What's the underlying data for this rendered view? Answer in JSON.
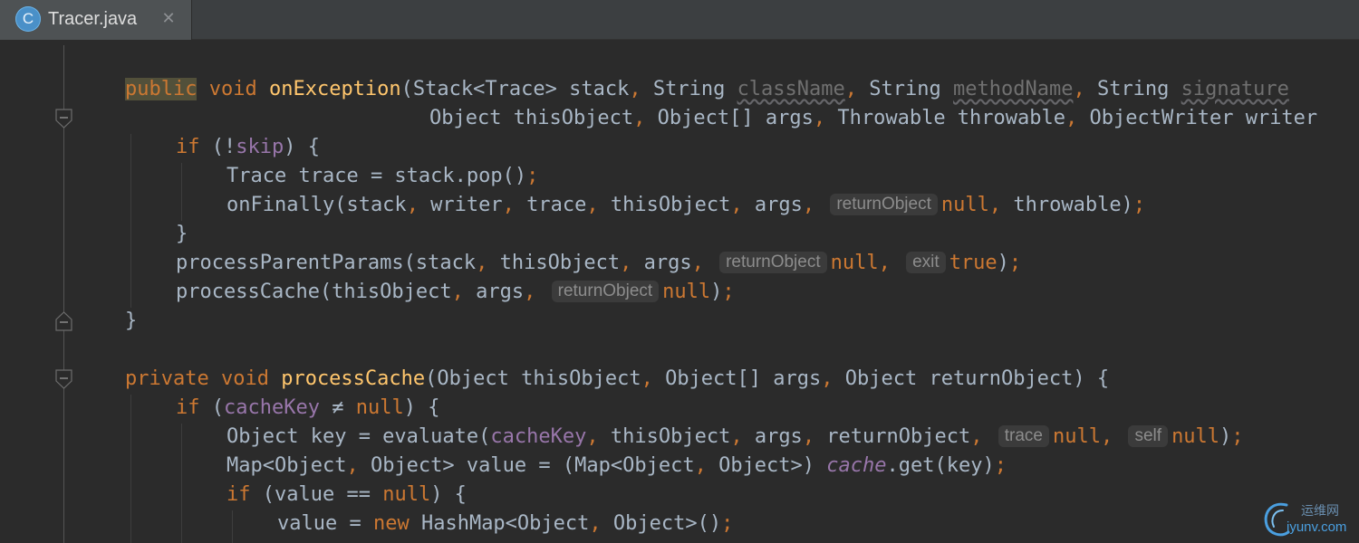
{
  "editor": {
    "tab": {
      "icon": "class-c-icon",
      "icon_letter": "C",
      "label": "Tracer.java",
      "close_glyph": "✕"
    },
    "colors": {
      "background": "#2b2b2b",
      "keyword": "#cc7832",
      "method": "#ffc66d",
      "field": "#9876aa",
      "text": "#a9b7c6",
      "hint_bg": "#3b3b3b",
      "hint_text": "#8c8c8c"
    },
    "lines": [
      [
        [
          "kw hl",
          "public"
        ],
        [
          "",
          " "
        ],
        [
          "kw",
          "void"
        ],
        [
          "",
          " "
        ],
        [
          "fn",
          "onException"
        ],
        [
          "",
          "(Stack<Trace> stack"
        ],
        [
          "pun",
          ","
        ],
        [
          "",
          " String "
        ],
        [
          "wavy",
          "className"
        ],
        [
          "pun",
          ","
        ],
        [
          "",
          " String "
        ],
        [
          "wavy",
          "methodName"
        ],
        [
          "pun",
          ","
        ],
        [
          "",
          " String "
        ],
        [
          "wavy",
          "signature"
        ]
      ],
      [
        [
          "",
          "Object thisObject"
        ],
        [
          "pun",
          ","
        ],
        [
          "",
          " Object[] args"
        ],
        [
          "pun",
          ","
        ],
        [
          "",
          " Throwable throwable"
        ],
        [
          "pun",
          ","
        ],
        [
          "",
          " ObjectWriter writer"
        ]
      ],
      [
        [
          "kw",
          "if"
        ],
        [
          "",
          " (!"
        ],
        [
          "fld",
          "skip"
        ],
        [
          "",
          ") {"
        ]
      ],
      [
        [
          "",
          "Trace trace = stack.pop()"
        ],
        [
          "pun",
          ";"
        ]
      ],
      [
        [
          "",
          "onFinally(stack"
        ],
        [
          "pun",
          ","
        ],
        [
          "",
          " writer"
        ],
        [
          "pun",
          ","
        ],
        [
          "",
          " trace"
        ],
        [
          "pun",
          ","
        ],
        [
          "",
          " thisObject"
        ],
        [
          "pun",
          ","
        ],
        [
          "",
          " args"
        ],
        [
          "pun",
          ","
        ],
        [
          "",
          " "
        ],
        [
          "hint",
          "returnObject"
        ],
        [
          "kw",
          "null"
        ],
        [
          "pun",
          ","
        ],
        [
          "",
          " throwable)"
        ],
        [
          "pun",
          ";"
        ]
      ],
      [
        [
          "",
          "}"
        ]
      ],
      [
        [
          "",
          "processParentParams(stack"
        ],
        [
          "pun",
          ","
        ],
        [
          "",
          " thisObject"
        ],
        [
          "pun",
          ","
        ],
        [
          "",
          " args"
        ],
        [
          "pun",
          ","
        ],
        [
          "",
          " "
        ],
        [
          "hint",
          "returnObject"
        ],
        [
          "kw",
          "null"
        ],
        [
          "pun",
          ","
        ],
        [
          "",
          " "
        ],
        [
          "hint",
          "exit"
        ],
        [
          "kw",
          "true"
        ],
        [
          "",
          ")"
        ],
        [
          "pun",
          ";"
        ]
      ],
      [
        [
          "",
          "processCache(thisObject"
        ],
        [
          "pun",
          ","
        ],
        [
          "",
          " args"
        ],
        [
          "pun",
          ","
        ],
        [
          "",
          " "
        ],
        [
          "hint",
          "returnObject"
        ],
        [
          "kw",
          "null"
        ],
        [
          "",
          ")"
        ],
        [
          "pun",
          ";"
        ]
      ],
      [
        [
          "",
          "}"
        ]
      ],
      [
        [
          "",
          ""
        ]
      ],
      [
        [
          "kw",
          "private"
        ],
        [
          "",
          " "
        ],
        [
          "kw",
          "void"
        ],
        [
          "",
          " "
        ],
        [
          "fn",
          "processCache"
        ],
        [
          "",
          "(Object thisObject"
        ],
        [
          "pun",
          ","
        ],
        [
          "",
          " Object[] args"
        ],
        [
          "pun",
          ","
        ],
        [
          "",
          " Object returnObject) {"
        ]
      ],
      [
        [
          "kw",
          "if"
        ],
        [
          "",
          " ("
        ],
        [
          "fld",
          "cacheKey"
        ],
        [
          "",
          " ≠ "
        ],
        [
          "kw",
          "null"
        ],
        [
          "",
          ") {"
        ]
      ],
      [
        [
          "",
          "Object key = evaluate("
        ],
        [
          "fld",
          "cacheKey"
        ],
        [
          "pun",
          ","
        ],
        [
          "",
          " thisObject"
        ],
        [
          "pun",
          ","
        ],
        [
          "",
          " args"
        ],
        [
          "pun",
          ","
        ],
        [
          "",
          " returnObject"
        ],
        [
          "pun",
          ","
        ],
        [
          "",
          " "
        ],
        [
          "hint",
          "trace"
        ],
        [
          "kw",
          "null"
        ],
        [
          "pun",
          ","
        ],
        [
          "",
          " "
        ],
        [
          "hint",
          "self"
        ],
        [
          "kw",
          "null"
        ],
        [
          "",
          ")"
        ],
        [
          "pun",
          ";"
        ]
      ],
      [
        [
          "",
          "Map<Object"
        ],
        [
          "pun",
          ","
        ],
        [
          "",
          " Object> value = (Map<Object"
        ],
        [
          "pun",
          ","
        ],
        [
          "",
          " Object>) "
        ],
        [
          "st",
          "cache"
        ],
        [
          "",
          ".get(key)"
        ],
        [
          "pun",
          ";"
        ]
      ],
      [
        [
          "kw",
          "if"
        ],
        [
          "",
          " (value == "
        ],
        [
          "kw",
          "null"
        ],
        [
          "",
          ") {"
        ]
      ],
      [
        [
          "",
          "value = "
        ],
        [
          "kw",
          "new"
        ],
        [
          "",
          " HashMap<Object"
        ],
        [
          "pun",
          ","
        ],
        [
          "",
          " Object>()"
        ],
        [
          "pun",
          ";"
        ]
      ]
    ]
  },
  "watermark": {
    "cn": "运维网",
    "en": "iyunv.com"
  }
}
